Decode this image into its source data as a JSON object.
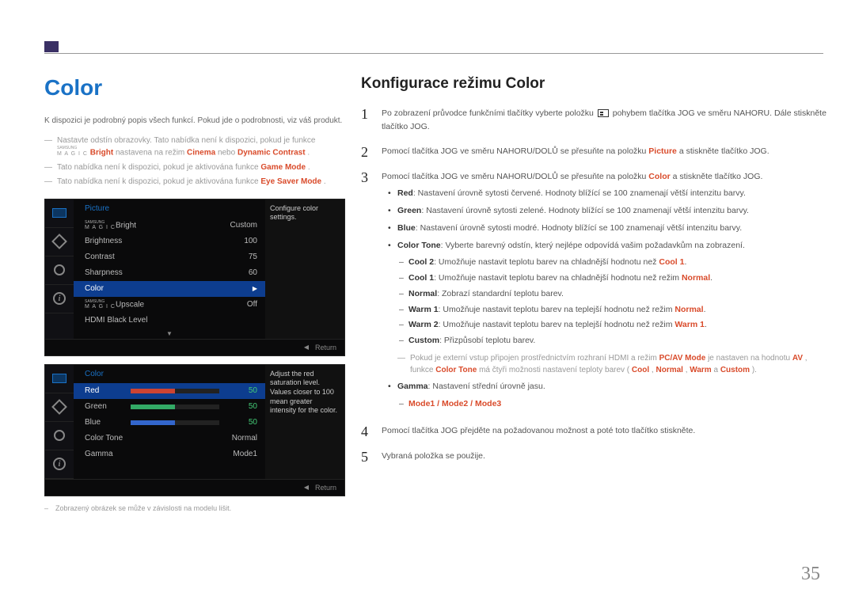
{
  "page_number": "35",
  "left": {
    "heading": "Color",
    "intro": "K dispozici je podrobný popis všech funkcí. Pokud jde o podrobnosti, viz váš produkt.",
    "dashes": [
      {
        "pre": "Nastavte odstín obrazovky. Tato nabídka není k dispozici, pokud je funkce ",
        "magic": "SAMSUNG MAGIC",
        "mid": "Bright",
        "mid2": " nastavena na režim ",
        "em1": "Cinema",
        "or": " nebo ",
        "em2": "Dynamic Contrast",
        "end": "."
      },
      {
        "pre": "Tato nabídka není k dispozici, pokud je aktivována funkce ",
        "em1": "Game Mode",
        "end": "."
      },
      {
        "pre": "Tato nabídka není k dispozici, pokud je aktivována funkce ",
        "em1": "Eye Saver Mode",
        "end": "."
      }
    ],
    "osd1": {
      "title": "Picture",
      "tip": "Configure color settings.",
      "rows": [
        {
          "label_pre": "",
          "magic": "SAMSUNG MAGIC",
          "label": "Bright",
          "value": "Custom"
        },
        {
          "label": "Brightness",
          "value": "100"
        },
        {
          "label": "Contrast",
          "value": "75"
        },
        {
          "label": "Sharpness",
          "value": "60"
        },
        {
          "label": "Color",
          "value": "",
          "selected": true,
          "arrow": "▶"
        },
        {
          "label_pre": "",
          "magic": "SAMSUNG MAGIC",
          "label": "Upscale",
          "value": "Off"
        },
        {
          "label": "HDMI Black Level",
          "value": ""
        }
      ],
      "return": "Return"
    },
    "osd2": {
      "title": "Color",
      "tip": "Adjust the red saturation level. Values closer to 100 mean greater intensity for the color.",
      "rows": [
        {
          "label": "Red",
          "value": "50",
          "selected": true,
          "bar": "red"
        },
        {
          "label": "Green",
          "value": "50",
          "bar": "green"
        },
        {
          "label": "Blue",
          "value": "50",
          "bar": "blue"
        },
        {
          "label": "Color Tone",
          "value": "Normal"
        },
        {
          "label": "Gamma",
          "value": "Mode1"
        }
      ],
      "return": "Return"
    },
    "footnote": "Zobrazený obrázek se může v závislosti na modelu lišit."
  },
  "right": {
    "heading": "Konfigurace režimu Color",
    "step1_a": "Po zobrazení průvodce funkčními tlačítky vyberte položku ",
    "step1_b": " pohybem tlačítka JOG ve směru NAHORU. Dále stiskněte tlačítko JOG.",
    "step2_a": "Pomocí tlačítka JOG ve směru NAHORU/DOLŮ se přesuňte na položku ",
    "step2_em": "Picture",
    "step2_b": " a stiskněte tlačítko JOG.",
    "step3_a": "Pomocí tlačítka JOG ve směru NAHORU/DOLŮ se přesuňte na položku ",
    "step3_em": "Color",
    "step3_b": " a stiskněte tlačítko JOG.",
    "bullets": {
      "red": {
        "k": "Red",
        "t": ": Nastavení úrovně sytosti červené. Hodnoty blížící se 100 znamenají větší intenzitu barvy."
      },
      "green": {
        "k": "Green",
        "t": ": Nastavení úrovně sytosti zelené. Hodnoty blížící se 100 znamenají větší intenzitu barvy."
      },
      "blue": {
        "k": "Blue",
        "t": ": Nastavení úrovně sytosti modré. Hodnoty blížící se 100 znamenají větší intenzitu barvy."
      },
      "colortone": {
        "k": "Color Tone",
        "t": ": Vyberte barevný odstín, který nejlépe odpovídá vašim požadavkům na zobrazení."
      },
      "gamma": {
        "k": "Gamma",
        "t": ": Nastavení střední úrovně jasu."
      }
    },
    "subs": {
      "cool2_a": "Cool 2",
      "cool2_b": ": Umožňuje nastavit teplotu barev na chladnější hodnotu než ",
      "cool2_c": "Cool 1",
      "cool2_d": ".",
      "cool1_a": "Cool 1",
      "cool1_b": ": Umožňuje nastavit teplotu barev na chladnější hodnotu než režim ",
      "cool1_c": "Normal",
      "cool1_d": ".",
      "normal_a": "Normal",
      "normal_b": ": Zobrazí standardní teplotu barev.",
      "warm1_a": "Warm 1",
      "warm1_b": ": Umožňuje nastavit teplotu barev na teplejší hodnotu než režim ",
      "warm1_c": "Normal",
      "warm1_d": ".",
      "warm2_a": "Warm 2",
      "warm2_b": ": Umožňuje nastavit teplotu barev na teplejší hodnotu než režim ",
      "warm2_c": "Warm 1",
      "warm2_d": ".",
      "custom_a": "Custom",
      "custom_b": ": Přizpůsobí teplotu barev.",
      "modes": "Mode1 / Mode2 / Mode3"
    },
    "note_a": "Pokud je externí vstup připojen prostřednictvím rozhraní HDMI a režim ",
    "note_em1": "PC/AV Mode",
    "note_b": " je nastaven na hodnotu ",
    "note_em2": "AV",
    "note_c": ", funkce ",
    "note_em3": "Color Tone",
    "note_d": " má čtyři možnosti nastavení teploty barev (",
    "note_em4": "Cool",
    "note_e": ", ",
    "note_em5": "Normal",
    "note_f": ", ",
    "note_em6": "Warm",
    "note_g": " a ",
    "note_em7": "Custom",
    "note_h": ").",
    "step4": "Pomocí tlačítka JOG přejděte na požadovanou možnost a poté toto tlačítko stiskněte.",
    "step5": "Vybraná položka se použije."
  }
}
